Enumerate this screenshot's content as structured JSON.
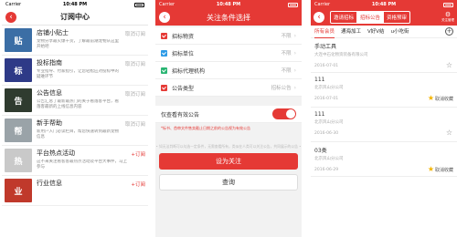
{
  "status": {
    "carrier": "Carrier",
    "time": "10:48 PM"
  },
  "p1": {
    "title": "订阅中心",
    "items": [
      {
        "title": "店铺小贴士",
        "desc": "宠物分享最火爆干货，了解最前潮宠物从这里开始吧",
        "action": "取消订阅",
        "subscribed": false,
        "thumb_color": "#3b6ea5",
        "thumb_glyph": "贴"
      },
      {
        "title": "投标指南",
        "desc": "专业指导、付家指引，让您轻松应对投标中的疑难环节",
        "action": "取消订阅",
        "subscribed": false,
        "thumb_color": "#2e3a87",
        "thumb_glyph": "标"
      },
      {
        "title": "公告信息",
        "desc": "公告汇总了最新最热门的关于看落客平台，看落客最新的上线信息内容",
        "action": "取消订阅",
        "subscribed": false,
        "thumb_color": "#2f3b2f",
        "thumb_glyph": "告"
      },
      {
        "title": "新手帮助",
        "desc": "新用户入门必读栏目，帮您快速转到最新宠物信息",
        "action": "取消订阅",
        "subscribed": false,
        "thumb_color": "#9aa3a8",
        "thumb_glyph": "帮"
      },
      {
        "title": "平台热点活动",
        "desc": "这不来关注看客客最热点活动及平台大事件，马上参与",
        "action": "+订阅",
        "subscribed": true,
        "thumb_color": "#c9c9c9",
        "thumb_glyph": "热"
      },
      {
        "title": "行业信息",
        "desc": "",
        "action": "+订阅",
        "subscribed": true,
        "thumb_color": "#c0392b",
        "thumb_glyph": "业"
      }
    ]
  },
  "p2": {
    "title": "关注条件选择",
    "rows": [
      {
        "label": "招标物资",
        "value": "不限",
        "color": "#e53935"
      },
      {
        "label": "招标单位",
        "value": "不限",
        "color": "#2e9be6"
      },
      {
        "label": "招标代理机构",
        "value": "不限",
        "color": "#2ab573"
      },
      {
        "label": "公告类型",
        "value": "招标公告",
        "color": "#e53935"
      }
    ],
    "toggle_label": "仅查看有效公告",
    "note": "*标书、首审文件售卖截止日期之前的公告视为有效公告",
    "hint": "• 如无法判断可以勾选一定条件，无需查看所有，类似在人类可以关注公告，共同展示的公告 •",
    "submit_label": "设为关注",
    "query_label": "查询"
  },
  "p3": {
    "segments": [
      "邀请招标",
      "招标公告",
      "资格预审"
    ],
    "right_label": "关注管理",
    "tabs": [
      "所有会员",
      "通海加工",
      "V好V结",
      "u小吃街"
    ],
    "news": [
      {
        "title": "手动工具",
        "sub": "大连中石化物资装备有限公司",
        "date": "2016-07-01",
        "fav": "",
        "faved": false
      },
      {
        "title": "111",
        "sub": "北京风山分公司",
        "date": "2016-07-01",
        "fav": "取消收藏",
        "faved": true
      },
      {
        "title": "111",
        "sub": "北京风山分公司",
        "date": "2016-06-30",
        "fav": "",
        "faved": false
      },
      {
        "title": "03类",
        "sub": "北京风山分公司",
        "date": "2016-06-29",
        "fav": "取消收藏",
        "faved": true
      }
    ]
  }
}
